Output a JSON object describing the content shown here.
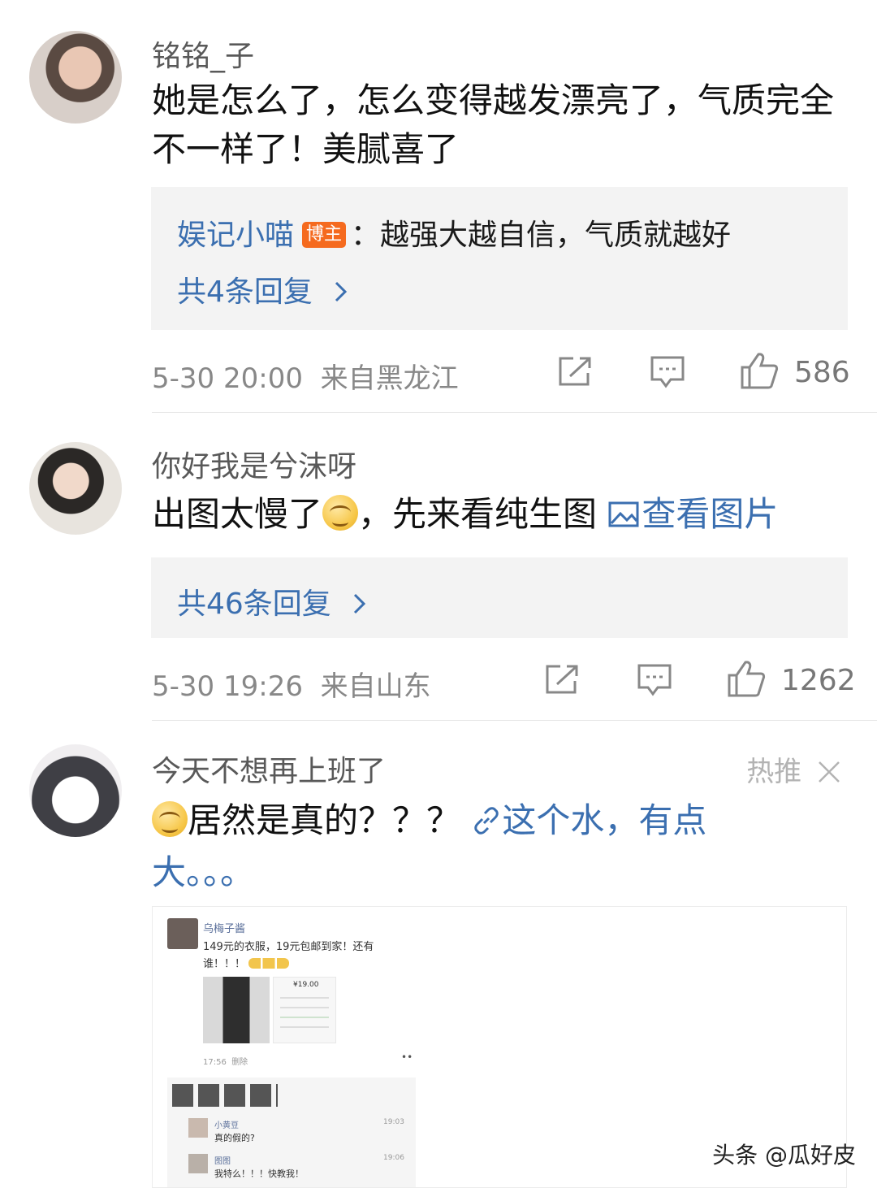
{
  "comments": [
    {
      "username": "铭铭_子",
      "text": "她是怎么了，怎么变得越发漂亮了，气质完全不一样了！美腻喜了",
      "reply_preview": {
        "name": "娱记小喵",
        "badge": "博主",
        "text": "：越强大越自信，气质就越好"
      },
      "reply_count": "共4条回复",
      "time": "5-30 20:00",
      "location": "来自黑龙江",
      "likes": "586"
    },
    {
      "username": "你好我是兮沫呀",
      "text_before": "出图太慢了",
      "text_after": "，先来看纯生图 ",
      "link": "查看图片",
      "reply_count": "共46条回复",
      "time": "5-30 19:26",
      "location": "来自山东",
      "likes": "1262"
    },
    {
      "username": "今天不想再上班了",
      "hot_label": "热推",
      "text": "居然是真的？？？ ",
      "link_line1": "这个水，有点",
      "link_line2": "大。。。"
    }
  ],
  "embedded_post": {
    "author": "乌梅子酱",
    "text_line1": "149元的衣服，19元包邮到家！还有",
    "text_line2": "谁！！！",
    "price": "¥19.00",
    "time": "17:56",
    "action": "删除",
    "replies": [
      {
        "name": "小黄豆",
        "text": "真的假的?",
        "time": "19:03"
      },
      {
        "name": "图图",
        "text": "我特么！！！快教我！",
        "time": "19:06"
      }
    ]
  },
  "watermark": "头条 @瓜好皮",
  "colors": {
    "link": "#3b6fb0",
    "badge": "#f56a1e",
    "meta": "#888888",
    "reply_box": "#f3f3f3"
  }
}
